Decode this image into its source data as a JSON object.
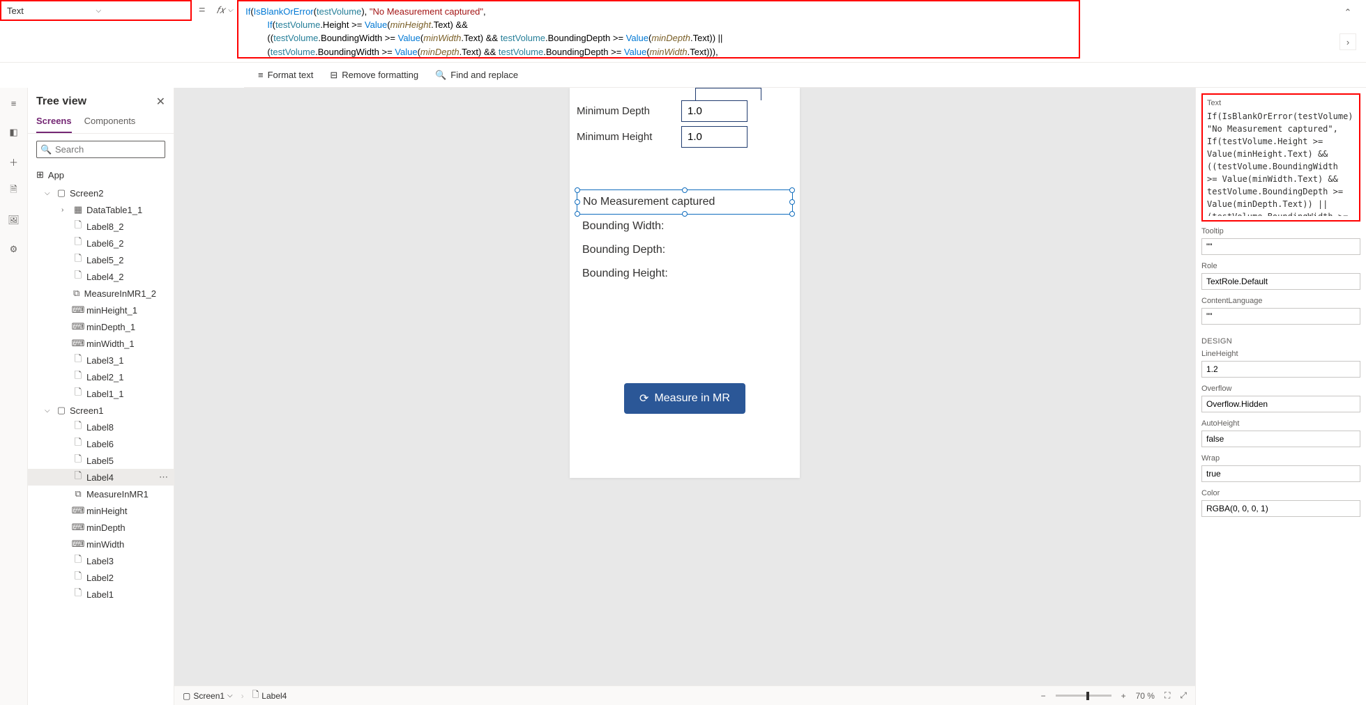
{
  "propertySelector": "Text",
  "formulaHtml": "<span class='tk-func'>If</span><span class='tk-punc'>(</span><span class='tk-func'>IsBlankOrError</span><span class='tk-punc'>(</span><span class='tk-var'>testVolume</span><span class='tk-punc'>), </span><span class='tk-str'>\"No Measurement captured\"</span><span class='tk-punc'>,</span>\n    <span class='tk-func'>If</span><span class='tk-punc'>(</span><span class='tk-var'>testVolume</span><span class='tk-punc'>.Height &gt;= </span><span class='tk-func'>Value</span><span class='tk-punc'>(</span><span class='tk-field'>minHeight</span><span class='tk-punc'>.Text) &amp;&amp;</span>\n    <span class='tk-punc'>((</span><span class='tk-var'>testVolume</span><span class='tk-punc'>.BoundingWidth &gt;= </span><span class='tk-func'>Value</span><span class='tk-punc'>(</span><span class='tk-field'>minWidth</span><span class='tk-punc'>.Text) &amp;&amp; </span><span class='tk-var'>testVolume</span><span class='tk-punc'>.BoundingDepth &gt;= </span><span class='tk-func'>Value</span><span class='tk-punc'>(</span><span class='tk-field'>minDepth</span><span class='tk-punc'>.Text)) ||</span>\n    <span class='tk-punc'>(</span><span class='tk-var'>testVolume</span><span class='tk-punc'>.BoundingWidth &gt;= </span><span class='tk-func'>Value</span><span class='tk-punc'>(</span><span class='tk-field'>minDepth</span><span class='tk-punc'>.Text) &amp;&amp; </span><span class='tk-var'>testVolume</span><span class='tk-punc'>.BoundingDepth &gt;= </span><span class='tk-func'>Value</span><span class='tk-punc'>(</span><span class='tk-field'>minWidth</span><span class='tk-punc'>.Text))),</span>\n    <span class='tk-str'>\"Fit Test Succeeded\"</span><span class='tk-punc'>, </span><span class='tk-str'>\"Fit Test Failed\"</span><span class='tk-punc'>))</span>",
  "actions": {
    "formatText": "Format text",
    "removeFormatting": "Remove formatting",
    "findReplace": "Find and replace"
  },
  "treeView": {
    "title": "Tree view",
    "tabs": {
      "screens": "Screens",
      "components": "Components"
    },
    "searchPlaceholder": "Search",
    "appLabel": "App",
    "nodes": [
      {
        "label": "Screen2",
        "icon": "screen",
        "indent": 0,
        "expanded": true
      },
      {
        "label": "DataTable1_1",
        "icon": "datatable",
        "indent": 1,
        "expandable": true
      },
      {
        "label": "Label8_2",
        "icon": "label",
        "indent": 1
      },
      {
        "label": "Label6_2",
        "icon": "label",
        "indent": 1
      },
      {
        "label": "Label5_2",
        "icon": "label",
        "indent": 1
      },
      {
        "label": "Label4_2",
        "icon": "label",
        "indent": 1
      },
      {
        "label": "MeasureInMR1_2",
        "icon": "component",
        "indent": 1
      },
      {
        "label": "minHeight_1",
        "icon": "input",
        "indent": 1
      },
      {
        "label": "minDepth_1",
        "icon": "input",
        "indent": 1
      },
      {
        "label": "minWidth_1",
        "icon": "input",
        "indent": 1
      },
      {
        "label": "Label3_1",
        "icon": "label",
        "indent": 1
      },
      {
        "label": "Label2_1",
        "icon": "label",
        "indent": 1
      },
      {
        "label": "Label1_1",
        "icon": "label",
        "indent": 1
      },
      {
        "label": "Screen1",
        "icon": "screen",
        "indent": 0,
        "expanded": true
      },
      {
        "label": "Label8",
        "icon": "label",
        "indent": 1
      },
      {
        "label": "Label6",
        "icon": "label",
        "indent": 1
      },
      {
        "label": "Label5",
        "icon": "label",
        "indent": 1
      },
      {
        "label": "Label4",
        "icon": "label",
        "indent": 1,
        "selected": true
      },
      {
        "label": "MeasureInMR1",
        "icon": "component",
        "indent": 1
      },
      {
        "label": "minHeight",
        "icon": "input",
        "indent": 1
      },
      {
        "label": "minDepth",
        "icon": "input",
        "indent": 1
      },
      {
        "label": "minWidth",
        "icon": "input",
        "indent": 1
      },
      {
        "label": "Label3",
        "icon": "label",
        "indent": 1
      },
      {
        "label": "Label2",
        "icon": "label",
        "indent": 1
      },
      {
        "label": "Label1",
        "icon": "label",
        "indent": 1
      }
    ]
  },
  "canvas": {
    "minDepthLabel": "Minimum Depth",
    "minDepthValue": "1.0",
    "minHeightLabel": "Minimum Height",
    "minHeightValue": "1.0",
    "resultText": "No Measurement captured",
    "boundingWidth": "Bounding Width:",
    "boundingDepth": "Bounding Depth:",
    "boundingHeight": "Bounding Height:",
    "measureButton": "Measure in MR"
  },
  "breadcrumb": {
    "screen": "Screen1",
    "control": "Label4"
  },
  "zoom": "70 %",
  "properties": {
    "textLabel": "Text",
    "textFormula": "If(IsBlankOrError(testVolume), \"No Measurement captured\",\nIf(testVolume.Height >= Value(minHeight.Text) && ((testVolume.BoundingWidth >= Value(minWidth.Text) && testVolume.BoundingDepth >= Value(minDepth.Text)) || (testVolume.BoundingWidth >= Value(minDepth.Text) &&",
    "tooltipLabel": "Tooltip",
    "tooltipValue": "\"\"",
    "roleLabel": "Role",
    "roleValue": "TextRole.Default",
    "contentLangLabel": "ContentLanguage",
    "contentLangValue": "\"\"",
    "designSection": "DESIGN",
    "lineHeightLabel": "LineHeight",
    "lineHeightValue": "1.2",
    "overflowLabel": "Overflow",
    "overflowValue": "Overflow.Hidden",
    "autoHeightLabel": "AutoHeight",
    "autoHeightValue": "false",
    "wrapLabel": "Wrap",
    "wrapValue": "true",
    "colorLabel": "Color",
    "colorValue": "RGBA(0, 0, 0, 1)"
  }
}
